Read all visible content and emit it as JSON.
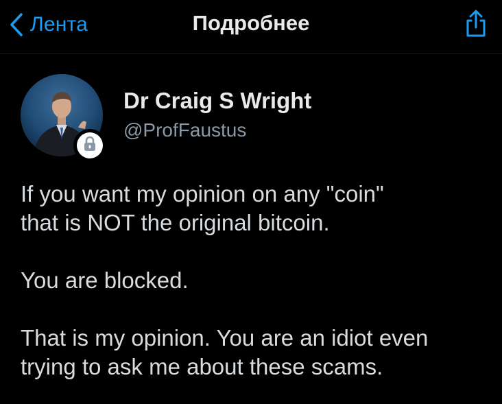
{
  "nav": {
    "back_label": "Лента",
    "title": "Подробнее",
    "back_icon": "chevron-left-icon",
    "share_icon": "share-icon",
    "accent_color": "#1d9bf0"
  },
  "tweet": {
    "display_name": "Dr Craig S Wright",
    "handle": "@ProfFaustus",
    "protected_icon": "lock-icon",
    "paragraphs": [
      "If you want my opinion on any \"coin\"\nthat is NOT the original bitcoin.",
      "You are blocked.",
      "That is my opinion. You are an idiot even\ntrying to ask me about these scams."
    ]
  }
}
